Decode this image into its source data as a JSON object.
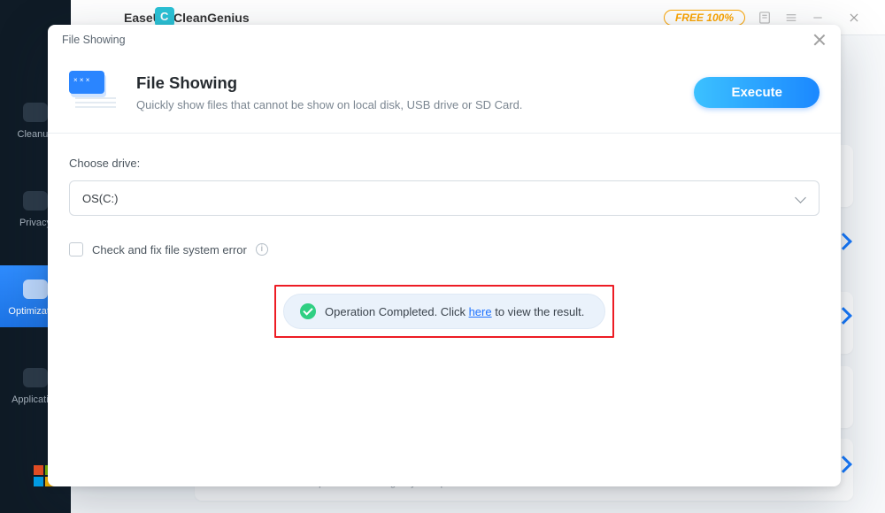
{
  "bg": {
    "app_name": "EaseUS CleanGenius",
    "free_badge": "FREE 100%",
    "sidebar": {
      "items": [
        {
          "label": "Cleanup"
        },
        {
          "label": "Privacy"
        },
        {
          "label": "Optimization"
        },
        {
          "label": "Application"
        }
      ]
    },
    "partial_desc": "Set Windows options according to your operation habits."
  },
  "dialog": {
    "title": "File Showing",
    "heading": "File Showing",
    "subheading": "Quickly show files that cannot be show on local disk, USB drive or SD Card.",
    "execute_label": "Execute",
    "choose_drive_label": "Choose drive:",
    "drive_value": "OS(C:)",
    "check_fs_label": "Check and fix file system error",
    "status": {
      "prefix": "Operation Completed. Click ",
      "link": "here",
      "suffix": " to view the result."
    }
  }
}
